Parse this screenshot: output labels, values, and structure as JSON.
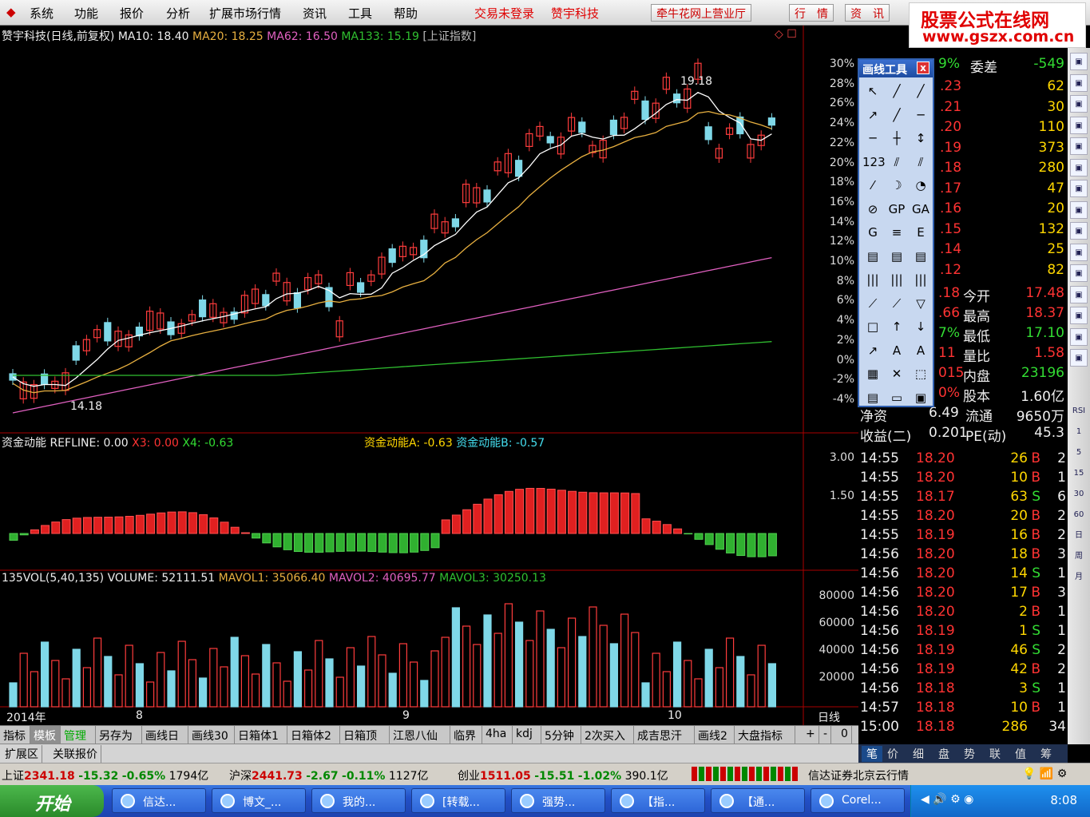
{
  "menu": {
    "items": [
      "系统",
      "功能",
      "报价",
      "分析",
      "扩展市场行情",
      "资讯",
      "工具",
      "帮助"
    ],
    "login_status": "交易未登录",
    "stock_name": "赞宇科技",
    "broker_button": "牵牛花网上营业厅",
    "quote_button": "行　情",
    "news_button": "资　讯"
  },
  "watermark": {
    "line1": "股票公式在线网",
    "line2": "www.gszx.com.cn"
  },
  "main_chart": {
    "title": "赞宇科技(日线,前复权)",
    "ma10": "MA10: 18.40",
    "ma20": "MA20: 18.25",
    "ma62": "MA62: 16.50",
    "ma133": "MA133: 15.19",
    "index_label": "[上证指数]",
    "high_label": "19.18",
    "low_label": "14.18",
    "pct_ticks": [
      "30%",
      "28%",
      "26%",
      "24%",
      "22%",
      "20%",
      "18%",
      "16%",
      "14%",
      "12%",
      "10%",
      "8%",
      "6%",
      "4%",
      "2%",
      "0%",
      "-2%",
      "-4%"
    ]
  },
  "indicator": {
    "name": "资金动能",
    "refline": "REFLINE: 0.00",
    "x3": "X3: 0.00",
    "x4": "X4: -0.63",
    "a": "资金动能A: -0.63",
    "b": "资金动能B: -0.57",
    "ticks": [
      "3.00",
      "1.50"
    ]
  },
  "volume": {
    "name": "135VOL(5,40,135)",
    "vol": "VOLUME: 52111.51",
    "mavol1": "MAVOL1: 35066.40",
    "mavol2": "MAVOL2: 40695.77",
    "mavol3": "MAVOL3: 30250.13",
    "ticks": [
      "80000",
      "60000",
      "40000",
      "20000"
    ]
  },
  "xaxis": {
    "labels": [
      "2014年",
      "8",
      "9",
      "10"
    ],
    "period": "日线"
  },
  "colors": {
    "up": "#ff3c3c",
    "down": "#7fd8e8",
    "ma10": "#ffffff",
    "ma20": "#e8b040",
    "ma62": "#e060c0",
    "ma133": "#30c030"
  },
  "draw_tool": {
    "title": "画线工具",
    "close": "x"
  },
  "right_panel": {
    "wei_pct": "9%",
    "wei_label": "委差",
    "wei_val": "-549",
    "orders": [
      [
        ".23",
        "62"
      ],
      [
        ".21",
        "30"
      ],
      [
        ".20",
        "110"
      ],
      [
        ".19",
        "373"
      ],
      [
        ".18",
        "280"
      ],
      [
        ".17",
        "47"
      ],
      [
        ".16",
        "20"
      ],
      [
        ".15",
        "132"
      ],
      [
        ".14",
        "25"
      ],
      [
        ".12",
        "82"
      ]
    ],
    "stats": [
      [
        ".18",
        "今开",
        "17.48"
      ],
      [
        ".66",
        "最高",
        "18.37"
      ],
      [
        "7%",
        "最低",
        "17.10"
      ],
      [
        "11",
        "量比",
        "1.58"
      ],
      [
        "015",
        "内盘",
        "23196"
      ],
      [
        "0%",
        "股本",
        "1.60亿"
      ],
      [
        "净资",
        "6.49",
        "流通",
        "9650万"
      ],
      [
        "收益(二)",
        "0.201",
        "PE(动)",
        "45.3"
      ]
    ],
    "ticks": [
      [
        "14:55",
        "18.20",
        "26",
        "B",
        "2"
      ],
      [
        "14:55",
        "18.20",
        "10",
        "B",
        "1"
      ],
      [
        "14:55",
        "18.17",
        "63",
        "S",
        "6"
      ],
      [
        "14:55",
        "18.20",
        "20",
        "B",
        "2"
      ],
      [
        "14:55",
        "18.19",
        "16",
        "B",
        "2"
      ],
      [
        "14:56",
        "18.20",
        "18",
        "B",
        "3"
      ],
      [
        "14:56",
        "18.20",
        "14",
        "S",
        "1"
      ],
      [
        "14:56",
        "18.20",
        "17",
        "B",
        "3"
      ],
      [
        "14:56",
        "18.20",
        "2",
        "B",
        "1"
      ],
      [
        "14:56",
        "18.19",
        "1",
        "S",
        "1"
      ],
      [
        "14:56",
        "18.19",
        "46",
        "S",
        "2"
      ],
      [
        "14:56",
        "18.19",
        "42",
        "B",
        "2"
      ],
      [
        "14:56",
        "18.18",
        "3",
        "S",
        "1"
      ],
      [
        "14:57",
        "18.18",
        "10",
        "B",
        "1"
      ],
      [
        "15:00",
        "18.18",
        "286",
        "",
        "34"
      ]
    ]
  },
  "tabs": [
    "指标",
    "模板",
    "管理",
    "另存为",
    "画线日",
    "画线30",
    "日箱体1",
    "日箱体2",
    "日箱顶",
    "江恩八仙",
    "临界",
    "4ha",
    "kdj",
    "5分钟",
    "2次买入",
    "成吉思汗",
    "画线2",
    "大盘指标"
  ],
  "tabs_misc": [
    "+",
    "-",
    "0"
  ],
  "tabs2": [
    "扩展区",
    "关联报价"
  ],
  "right_tabs": [
    "笔",
    "价",
    "细",
    "盘",
    "势",
    "联",
    "值",
    "筹"
  ],
  "vtool": [
    "RSI",
    "1",
    "5",
    "15",
    "30",
    "60",
    "日",
    "周",
    "月"
  ],
  "status": {
    "sh_label": "上证",
    "sh_val": "2341.18",
    "sh_chg": "-15.32",
    "sh_pct": "-0.65%",
    "sh_amt": "1794亿",
    "hs_label": "沪深",
    "hs_val": "2441.73",
    "hs_chg": "-2.67",
    "hs_pct": "-0.11%",
    "hs_amt": "1127亿",
    "cy_label": "创业",
    "cy_val": "1511.05",
    "cy_chg": "-15.51",
    "cy_pct": "-1.02%",
    "cy_amt": "390.1亿",
    "server": "信达证券北京云行情"
  },
  "taskbar": {
    "start": "开始",
    "tasks": [
      "信达...",
      "博文_...",
      "我的...",
      "[转载...",
      "强势...",
      "【指...",
      "【通...",
      "Corel..."
    ],
    "clock": "8:08"
  }
}
